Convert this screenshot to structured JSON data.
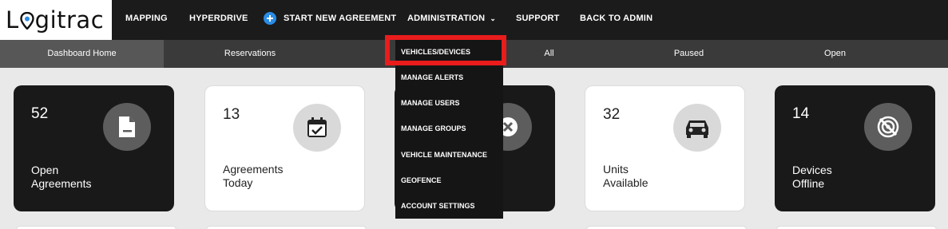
{
  "brand": {
    "logo_text_left": "L",
    "logo_text_right": "gitrac"
  },
  "topnav": {
    "mapping": "MAPPING",
    "hyperdrive": "HYPERDRIVE",
    "start_new": "START NEW AGREEMENT",
    "administration": "ADMINISTRATION",
    "support": "SUPPORT",
    "back_to_admin": "BACK TO ADMIN"
  },
  "subnav": {
    "dashboard_home": "Dashboard Home",
    "reservations": "Reservations",
    "all": "All",
    "paused": "Paused",
    "open": "Open"
  },
  "cards": [
    {
      "value": "52",
      "label_line1": "Open",
      "label_line2": "Agreements",
      "icon": "document-icon"
    },
    {
      "value": "13",
      "label_line1": "Agreements",
      "label_line2": "Today",
      "icon": "calendar-check-icon"
    },
    {
      "value": "",
      "label_line1": "",
      "label_line2": "",
      "icon": "close-circle-icon"
    },
    {
      "value": "32",
      "label_line1": "Units",
      "label_line2": "Available",
      "icon": "car-icon"
    },
    {
      "value": "14",
      "label_line1": "Devices",
      "label_line2": "Offline",
      "icon": "signal-off-icon"
    }
  ],
  "admin_menu": {
    "items": [
      "VEHICLES/DEVICES",
      "MANAGE ALERTS",
      "MANAGE USERS",
      "MANAGE GROUPS",
      "VEHICLE MAINTENANCE",
      "GEOFENCE",
      "ACCOUNT SETTINGS"
    ]
  },
  "colors": {
    "highlight": "#ea1c1c",
    "accent": "#2b8ce6",
    "dark": "#191919"
  }
}
